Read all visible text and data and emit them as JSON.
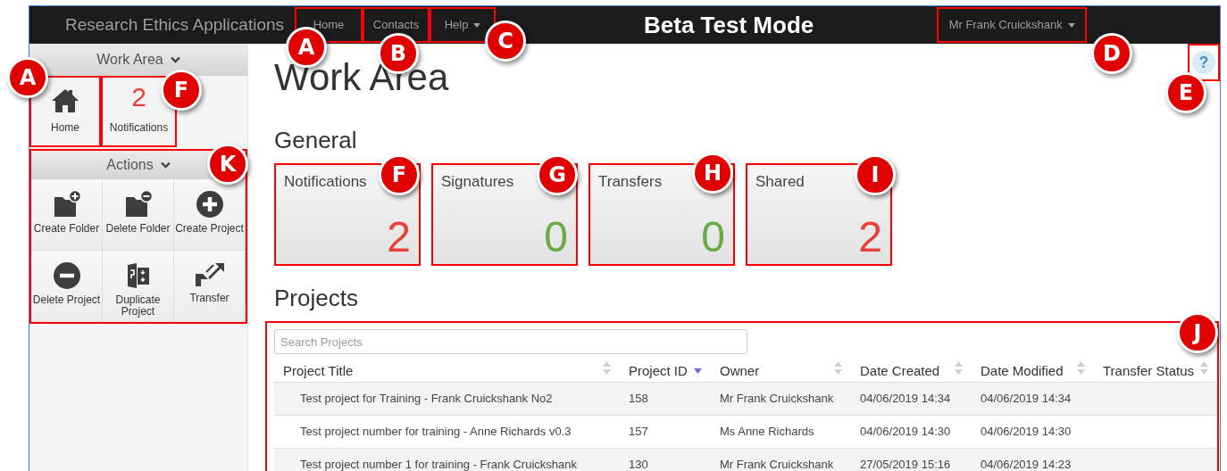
{
  "nav": {
    "brand": "Research Ethics Applications",
    "links": [
      {
        "label": "Home",
        "dropdown": false
      },
      {
        "label": "Contacts",
        "dropdown": false
      },
      {
        "label": "Help",
        "dropdown": true
      }
    ],
    "mode": "Beta Test Mode",
    "user": {
      "label": "Mr Frank Cruickshank",
      "dropdown": true
    }
  },
  "sidebar": {
    "work_area": {
      "title": "Work Area",
      "tiles": [
        {
          "kind": "home",
          "label": "Home"
        },
        {
          "kind": "count",
          "count": "2",
          "label": "Notifications"
        }
      ]
    },
    "actions": {
      "title": "Actions",
      "items": [
        {
          "kind": "folder-plus",
          "label": "Create Folder"
        },
        {
          "kind": "folder-minus",
          "label": "Delete Folder"
        },
        {
          "kind": "circle-plus",
          "label": "Create Project"
        },
        {
          "kind": "circle-minus",
          "label": "Delete Project"
        },
        {
          "kind": "duplicate",
          "label": "Duplicate Project"
        },
        {
          "kind": "transfer",
          "label": "Transfer"
        }
      ]
    }
  },
  "main": {
    "title": "Work Area",
    "general": {
      "title": "General",
      "cards": [
        {
          "label": "Notifications",
          "value": "2",
          "color": "#e8413c"
        },
        {
          "label": "Signatures",
          "value": "0",
          "color": "#6aaa47"
        },
        {
          "label": "Transfers",
          "value": "0",
          "color": "#6aaa47"
        },
        {
          "label": "Shared",
          "value": "2",
          "color": "#e8413c"
        }
      ]
    },
    "projects": {
      "title": "Projects",
      "search": {
        "placeholder": "Search Projects"
      },
      "columns": [
        {
          "label": "Project Title",
          "sorted": false
        },
        {
          "label": "Project ID",
          "sorted": true
        },
        {
          "label": "Owner",
          "sorted": false
        },
        {
          "label": "Date Created",
          "sorted": false
        },
        {
          "label": "Date Modified",
          "sorted": false
        },
        {
          "label": "Transfer Status",
          "sorted": false
        }
      ],
      "rows": [
        {
          "cells": [
            "Test project for Training - Frank Cruickshank No2",
            "158",
            "Mr Frank Cruickshank",
            "04/06/2019 14:34",
            "04/06/2019 14:34"
          ]
        },
        {
          "cells": [
            "Test project number for training - Anne Richards v0.3",
            "157",
            "Ms Anne Richards",
            "04/06/2019 14:30",
            "04/06/2019 14:30"
          ]
        },
        {
          "cells": [
            "Test project number 1 for training - Frank Cruickshank",
            "130",
            "Mr Frank Cruickshank",
            "27/05/2019 15:16",
            "04/06/2019 14:23"
          ]
        }
      ]
    }
  },
  "help": {
    "label": "?"
  },
  "callouts": [
    {
      "letter": "A"
    },
    {
      "letter": "B"
    },
    {
      "letter": "C"
    },
    {
      "letter": "D"
    },
    {
      "letter": "E"
    },
    {
      "letter": "A"
    },
    {
      "letter": "F"
    },
    {
      "letter": "K"
    },
    {
      "letter": "F"
    },
    {
      "letter": "G"
    },
    {
      "letter": "H"
    },
    {
      "letter": "I"
    },
    {
      "letter": "J"
    }
  ]
}
